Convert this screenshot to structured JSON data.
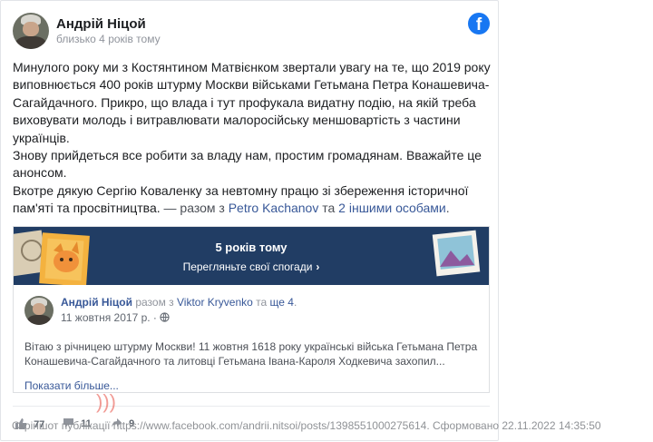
{
  "post": {
    "author": "Андрій Ніцой",
    "time": "близько 4 років тому",
    "paragraphs": [
      "Минулого року ми з Костянтином Матвієнком звертали увагу на те, що 2019 року виповнюється 400 років штурму Москви військами Гетьмана Петра Конашевича-Сагайдачного. Прикро, що влада і тут профукала видатну подію, на якій треба виховувати молодь і витравлювати малоросійську меншовартість з частини українців.",
      "Знову прийдеться все робити за владу нам, простим громадянам. Вважайте це анонсом.",
      "Вкотре дякую Сергію Коваленку за невтомну працю зі збереження історичної пам'яті та просвітництва."
    ],
    "tag_prefix": " — разом з ",
    "tag_person": "Petro Kachanov",
    "tag_mid": " та ",
    "tag_others": "2 іншими особами",
    "tag_end": "."
  },
  "memory": {
    "title": "5 років тому",
    "subtitle": "Перегляньте свої спогади",
    "inner_author": "Андрій Ніцой",
    "inner_with": " разом з ",
    "inner_person": "Viktor Kryvenko",
    "inner_and": " та ",
    "inner_more": "ще 4",
    "inner_dot": ".",
    "inner_date": "11 жовтня 2017 р. · ",
    "inner_text": "Вітаю з річницею штурму Москви! 11 жовтня 1618 року українські війська Гетьмана Петра Конашевича-Сагайдачного та литовці Гетьмана Івана-Кароля Ходкевича захопил...",
    "see_more": "Показати більше..."
  },
  "stats": {
    "likes": "77",
    "comments": "11",
    "shares": "9"
  },
  "caption": "Скріншот публікації https://www.facebook.com/andrii.nitsoi/posts/1398551000275614. Сформовано 22.11.2022 14:35:50",
  "colors": {
    "facebook_blue": "#1877f2",
    "banner_bg": "#213d64",
    "link": "#385898"
  },
  "icons": [
    "facebook-logo-icon",
    "globe-icon",
    "like-icon",
    "comment-icon",
    "share-icon",
    "chevron-right-icon"
  ]
}
